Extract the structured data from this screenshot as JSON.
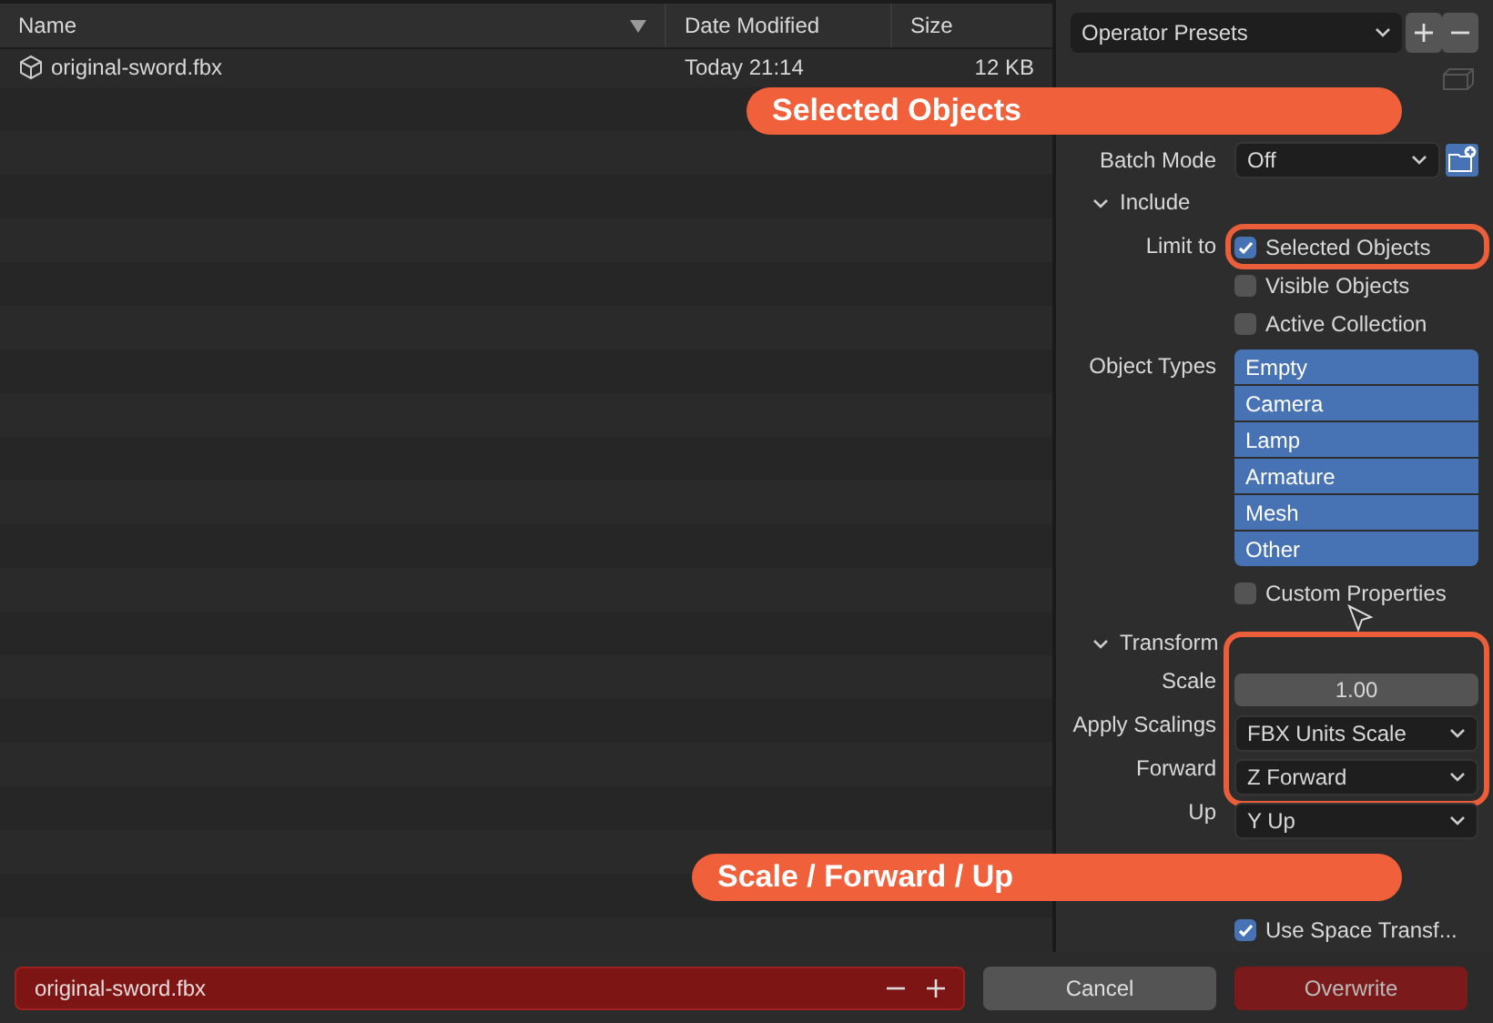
{
  "file_list": {
    "columns": [
      {
        "label": "Name",
        "sorted": true
      },
      {
        "label": "Date Modified",
        "sorted": false
      },
      {
        "label": "Size",
        "sorted": false
      }
    ],
    "files": [
      {
        "name": "original-sword.fbx",
        "date": "Today 21:14",
        "size": "12 KB"
      }
    ]
  },
  "operator_presets": {
    "label": "Operator Presets"
  },
  "batch_mode": {
    "label": "Batch Mode",
    "value": "Off"
  },
  "include": {
    "title": "Include",
    "expanded": true,
    "limit_to": {
      "label": "Limit to",
      "options": [
        {
          "label": "Selected Objects",
          "checked": true
        },
        {
          "label": "Visible Objects",
          "checked": false
        },
        {
          "label": "Active Collection",
          "checked": false
        }
      ]
    },
    "object_types": {
      "label": "Object Types",
      "items": [
        {
          "label": "Empty",
          "selected": true
        },
        {
          "label": "Camera",
          "selected": true
        },
        {
          "label": "Lamp",
          "selected": true
        },
        {
          "label": "Armature",
          "selected": true
        },
        {
          "label": "Mesh",
          "selected": true
        },
        {
          "label": "Other",
          "selected": true
        }
      ]
    },
    "custom_properties": {
      "label": "Custom Properties",
      "checked": false
    }
  },
  "transform": {
    "title": "Transform",
    "expanded": true,
    "fields": [
      {
        "kind": "number",
        "label": "Scale",
        "value": "1.00"
      },
      {
        "kind": "dropdown",
        "label": "Apply Scalings",
        "value": "FBX Units Scale"
      },
      {
        "kind": "dropdown",
        "label": "Forward",
        "value": "Z Forward"
      },
      {
        "kind": "dropdown",
        "label": "Up",
        "value": "Y Up"
      }
    ],
    "use_space_transform": {
      "label": "Use Space Transf...",
      "checked": true
    }
  },
  "footer": {
    "filename": "original-sword.fbx",
    "buttons": [
      {
        "label": "Cancel",
        "kind": "secondary"
      },
      {
        "label": "Overwrite",
        "kind": "primary"
      }
    ]
  },
  "callouts": [
    {
      "text": "Selected Objects"
    },
    {
      "text": "Scale / Forward / Up"
    }
  ]
}
